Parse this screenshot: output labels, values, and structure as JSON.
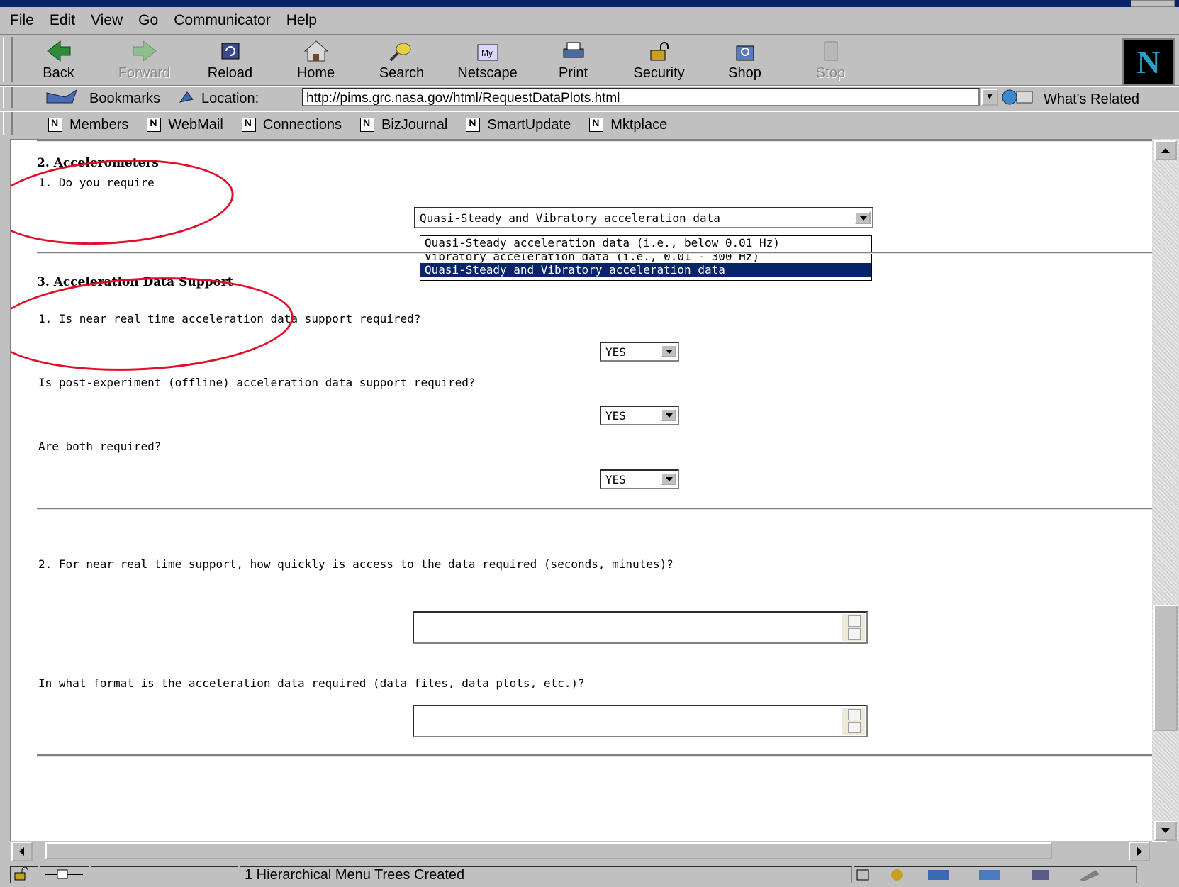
{
  "menu": [
    "File",
    "Edit",
    "View",
    "Go",
    "Communicator",
    "Help"
  ],
  "nav": {
    "buttons": [
      {
        "label": "Back",
        "icon": "back-arrow-icon",
        "enabled": true
      },
      {
        "label": "Forward",
        "icon": "forward-arrow-icon",
        "enabled": false
      },
      {
        "label": "Reload",
        "icon": "reload-icon",
        "enabled": true
      },
      {
        "label": "Home",
        "icon": "home-icon",
        "enabled": true
      },
      {
        "label": "Search",
        "icon": "search-icon",
        "enabled": true
      },
      {
        "label": "Netscape",
        "icon": "netscape-icon",
        "enabled": true
      },
      {
        "label": "Print",
        "icon": "printer-icon",
        "enabled": true
      },
      {
        "label": "Security",
        "icon": "lock-icon",
        "enabled": true
      },
      {
        "label": "Shop",
        "icon": "shop-icon",
        "enabled": true
      },
      {
        "label": "Stop",
        "icon": "stop-icon",
        "enabled": false
      }
    ],
    "logo": "N"
  },
  "location": {
    "bookmarks_label": "Bookmarks",
    "label": "Location:",
    "url": "http://pims.grc.nasa.gov/html/RequestDataPlots.html",
    "related_label": "What's Related"
  },
  "personal": [
    "Members",
    "WebMail",
    "Connections",
    "BizJournal",
    "SmartUpdate",
    "Mktplace"
  ],
  "form": {
    "s2_title": "2. Accelerometers",
    "s2_q1": "1. Do you require",
    "s2_select_value": "Quasi-Steady and Vibratory acceleration data",
    "s2_options": [
      "Quasi-Steady acceleration data (i.e., below 0.01 Hz)",
      "Vibratory acceleration data (i.e., 0.01 - 300 Hz)",
      "Quasi-Steady and Vibratory acceleration data"
    ],
    "s3_title": "3. Acceleration Data Support",
    "s3_q1": "1. Is near real time acceleration data support required?",
    "s3_q1_value": "YES",
    "s3_q1b": "Is post-experiment (offline) acceleration data support required?",
    "s3_q1b_value": "YES",
    "s3_q1c": "Are both required?",
    "s3_q1c_value": "YES",
    "s3_q2": "2. For near real time support, how quickly is access to the data required (seconds, minutes)?",
    "s3_q2_value": "",
    "s3_q3": "In what format is the acceleration data required (data files, data plots, etc.)?",
    "s3_q3_value": ""
  },
  "status": {
    "text": "1 Hierarchical Menu Trees Created"
  },
  "colors": {
    "highlight": "#0a246a",
    "annotation": "#e0102a"
  }
}
